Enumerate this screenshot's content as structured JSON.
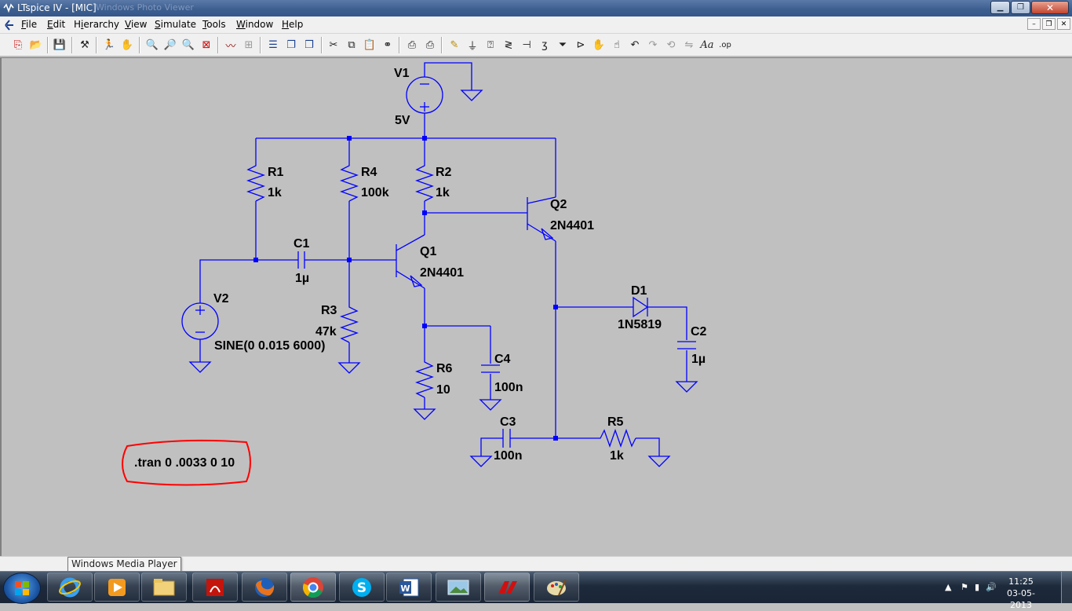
{
  "window": {
    "title": "LTspice IV - [MIC]",
    "ghost_title": "Windows Photo Viewer"
  },
  "menu": [
    {
      "label": "File",
      "underline": "F"
    },
    {
      "label": "Edit",
      "underline": "E"
    },
    {
      "label": "Hierarchy",
      "underline": "i"
    },
    {
      "label": "View",
      "underline": "V"
    },
    {
      "label": "Simulate",
      "underline": "S"
    },
    {
      "label": "Tools",
      "underline": "T"
    },
    {
      "label": "Window",
      "underline": "W"
    },
    {
      "label": "Help",
      "underline": "H"
    }
  ],
  "schematic": {
    "colors": {
      "wire": "#0000ff",
      "background": "#c0c0c0",
      "junction": "#0000ff",
      "annotation": "#ff0000"
    },
    "components": {
      "V1": {
        "name": "V1",
        "value": "5V"
      },
      "V2": {
        "name": "V2",
        "value": "SINE(0 0.015 6000)"
      },
      "R1": {
        "name": "R1",
        "value": "1k"
      },
      "R2": {
        "name": "R2",
        "value": "1k"
      },
      "R3": {
        "name": "R3",
        "value": "47k"
      },
      "R4": {
        "name": "R4",
        "value": "100k"
      },
      "R5": {
        "name": "R5",
        "value": "1k"
      },
      "R6": {
        "name": "R6",
        "value": "10"
      },
      "C1": {
        "name": "C1",
        "value": "1µ"
      },
      "C2": {
        "name": "C2",
        "value": "1µ"
      },
      "C3": {
        "name": "C3",
        "value": "100n"
      },
      "C4": {
        "name": "C4",
        "value": "100n"
      },
      "Q1": {
        "name": "Q1",
        "value": "2N4401"
      },
      "Q2": {
        "name": "Q2",
        "value": "2N4401"
      },
      "D1": {
        "name": "D1",
        "value": "1N5819"
      }
    },
    "directive": ".tran 0 .0033 0 10"
  },
  "tooltip": "Windows Media Player",
  "taskbar": {
    "apps": [
      "internet-explorer-icon",
      "windows-media-player-icon",
      "file-explorer-icon",
      "adobe-reader-icon",
      "firefox-icon",
      "chrome-icon",
      "skype-icon",
      "word-icon",
      "photo-viewer-icon",
      "ltspice-icon",
      "paint-icon"
    ],
    "clock_time": "11:25",
    "clock_date": "03-05-2013"
  }
}
